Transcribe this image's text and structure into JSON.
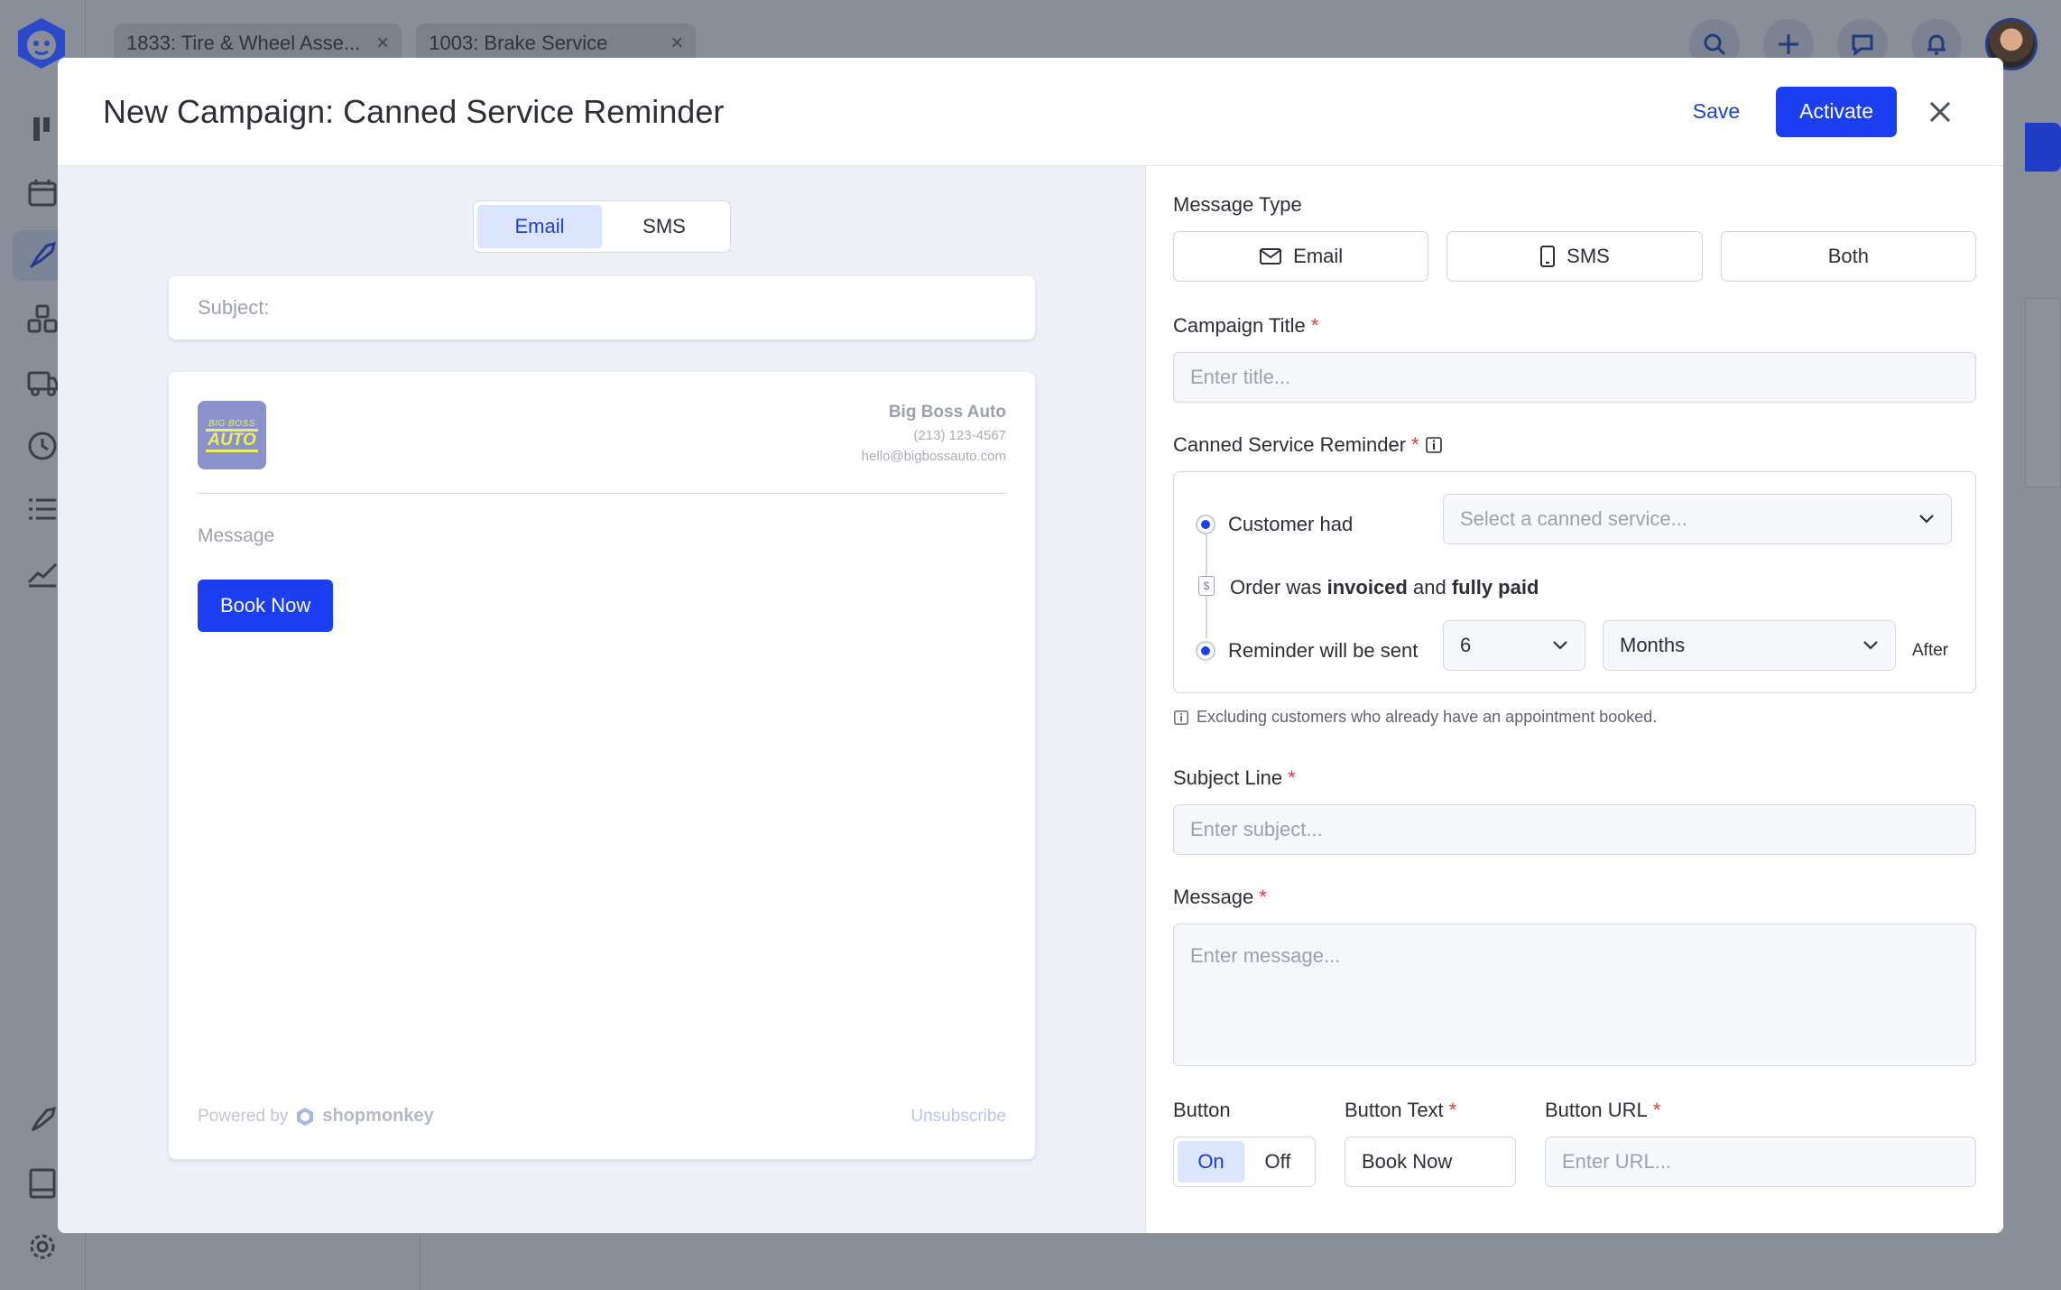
{
  "bg": {
    "tabs": [
      {
        "label": "1833: Tire & Wheel Asse..."
      },
      {
        "label": "1003: Brake Service"
      }
    ]
  },
  "modal": {
    "title": "New Campaign: Canned Service Reminder",
    "save_label": "Save",
    "activate_label": "Activate"
  },
  "preview": {
    "tabs": [
      {
        "label": "Email"
      },
      {
        "label": "SMS"
      }
    ],
    "active_tab": "Email",
    "subject_label": "Subject:",
    "logo_top": "BIG BOSS",
    "logo_main": "AUTO",
    "shop_name": "Big Boss Auto",
    "shop_phone": "(213) 123-4567",
    "shop_email": "hello@bigbossauto.com",
    "message_placeholder": "Message",
    "button_label": "Book Now",
    "powered_by": "Powered by",
    "brand": "shopmonkey",
    "unsubscribe": "Unsubscribe"
  },
  "form": {
    "message_type_label": "Message Type",
    "message_types": [
      {
        "label": "Email",
        "icon": "mail-icon"
      },
      {
        "label": "SMS",
        "icon": "phone-icon"
      },
      {
        "label": "Both"
      }
    ],
    "campaign_title_label": "Campaign Title",
    "campaign_title_placeholder": "Enter title...",
    "reminder_label": "Canned Service Reminder",
    "customer_had": "Customer had",
    "canned_service_placeholder": "Select a canned service...",
    "order_text_1": "Order was",
    "order_bold_1": "invoiced",
    "order_text_2": "and",
    "order_bold_2": "fully paid",
    "reminder_sent": "Reminder will be sent",
    "interval_value": "6",
    "interval_unit": "Months",
    "after": "After",
    "note": "Excluding customers who already have an appointment booked.",
    "subject_line_label": "Subject Line",
    "subject_placeholder": "Enter subject...",
    "message_label": "Message",
    "message_placeholder": "Enter message...",
    "button_label": "Button",
    "button_on": "On",
    "button_off": "Off",
    "button_text_label": "Button Text",
    "button_text_value": "Book Now",
    "button_url_label": "Button URL",
    "button_url_placeholder": "Enter URL...",
    "required_mark": "*"
  },
  "colors": {
    "accent": "#1b3ef0",
    "accent_soft": "#dce5ff",
    "required": "#e03a3a"
  }
}
